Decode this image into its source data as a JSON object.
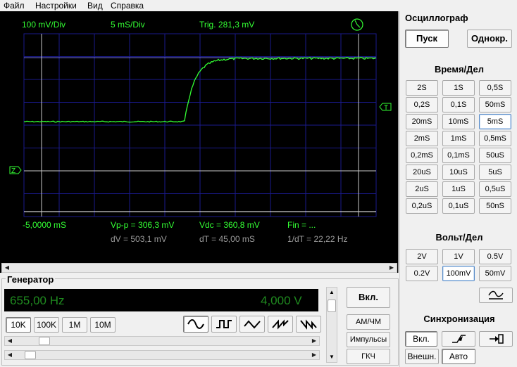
{
  "menu": [
    "Файл",
    "Настройки",
    "Вид",
    "Справка"
  ],
  "scope": {
    "volts_div": "100 mV/Div",
    "time_div": "5 mS/Div",
    "trig": "Trig. 281,3 mV",
    "time_offset": "-5,0000 mS",
    "vpp": "Vp-p = 306,3 mV",
    "vdc": "Vdc = 360,8 mV",
    "fin": "Fin = ...",
    "dv": "dV = 503,1 mV",
    "dt": "dT = 45,00 mS",
    "inv_dt": "1/dT = 22,22 Hz",
    "trigger_marker": "T",
    "zero_marker": "Z",
    "colors": {
      "trace": "#33ff33",
      "grid": "#1a1a8c",
      "background": "#000000"
    }
  },
  "generator": {
    "title": "Генератор",
    "frequency": "655,00 Hz",
    "amplitude": "4,000 V",
    "range_buttons": [
      "10K",
      "100K",
      "1M",
      "10M"
    ],
    "selected_range": "10K",
    "waveforms": [
      "sine-icon",
      "square-icon",
      "triangle-icon",
      "sawtooth-up-icon",
      "sawtooth-down-icon"
    ],
    "on_label": "Вкл.",
    "am_fm": "АМ/ЧМ",
    "pulses": "Импульсы",
    "sweep": "ГКЧ"
  },
  "panel": {
    "title": "Осциллограф",
    "start": "Пуск",
    "single": "Однокр.",
    "time_title": "Время/Дел",
    "time_buttons": [
      "2S",
      "1S",
      "0,5S",
      "0,2S",
      "0,1S",
      "50mS",
      "20mS",
      "10mS",
      "5mS",
      "2mS",
      "1mS",
      "0,5mS",
      "0,2mS",
      "0,1mS",
      "50uS",
      "20uS",
      "10uS",
      "5uS",
      "2uS",
      "1uS",
      "0,5uS",
      "0,2uS",
      "0,1uS",
      "50nS"
    ],
    "selected_time": "5mS",
    "volt_title": "Вольт/Дел",
    "volt_buttons": [
      "2V",
      "1V",
      "0.5V",
      "0.2V",
      "100mV",
      "50mV"
    ],
    "selected_volt": "100mV",
    "sync_title": "Синхронизация",
    "sync_on": "Вкл.",
    "sync_ext": "Внешн.",
    "sync_auto": "Авто"
  }
}
